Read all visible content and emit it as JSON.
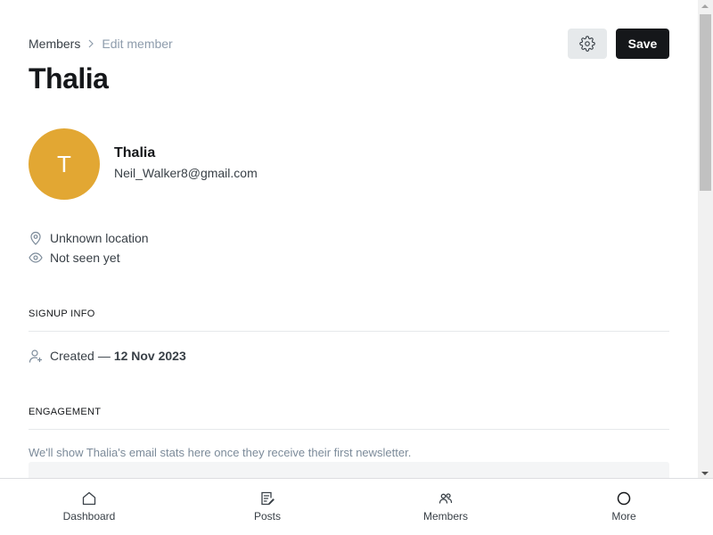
{
  "breadcrumb": {
    "root": "Members",
    "current": "Edit member"
  },
  "header": {
    "save_label": "Save",
    "settings_icon": "gear-icon"
  },
  "page": {
    "title": "Thalia"
  },
  "member": {
    "initial": "T",
    "name": "Thalia",
    "email": "Neil_Walker8@gmail.com",
    "avatar_color": "#e2a733",
    "location": "Unknown location",
    "seen": "Not seen yet"
  },
  "signup": {
    "section_label": "SIGNUP INFO",
    "created_label": "Created",
    "created_dash": "—",
    "created_date": "12 Nov 2023"
  },
  "engagement": {
    "section_label": "ENGAGEMENT",
    "note": "We'll show Thalia's email stats here once they receive their first newsletter."
  },
  "bottom_nav": {
    "items": [
      {
        "label": "Dashboard",
        "icon": "home-icon"
      },
      {
        "label": "Posts",
        "icon": "posts-icon"
      },
      {
        "label": "Members",
        "icon": "members-icon"
      },
      {
        "label": "More",
        "icon": "circle-icon"
      }
    ]
  }
}
